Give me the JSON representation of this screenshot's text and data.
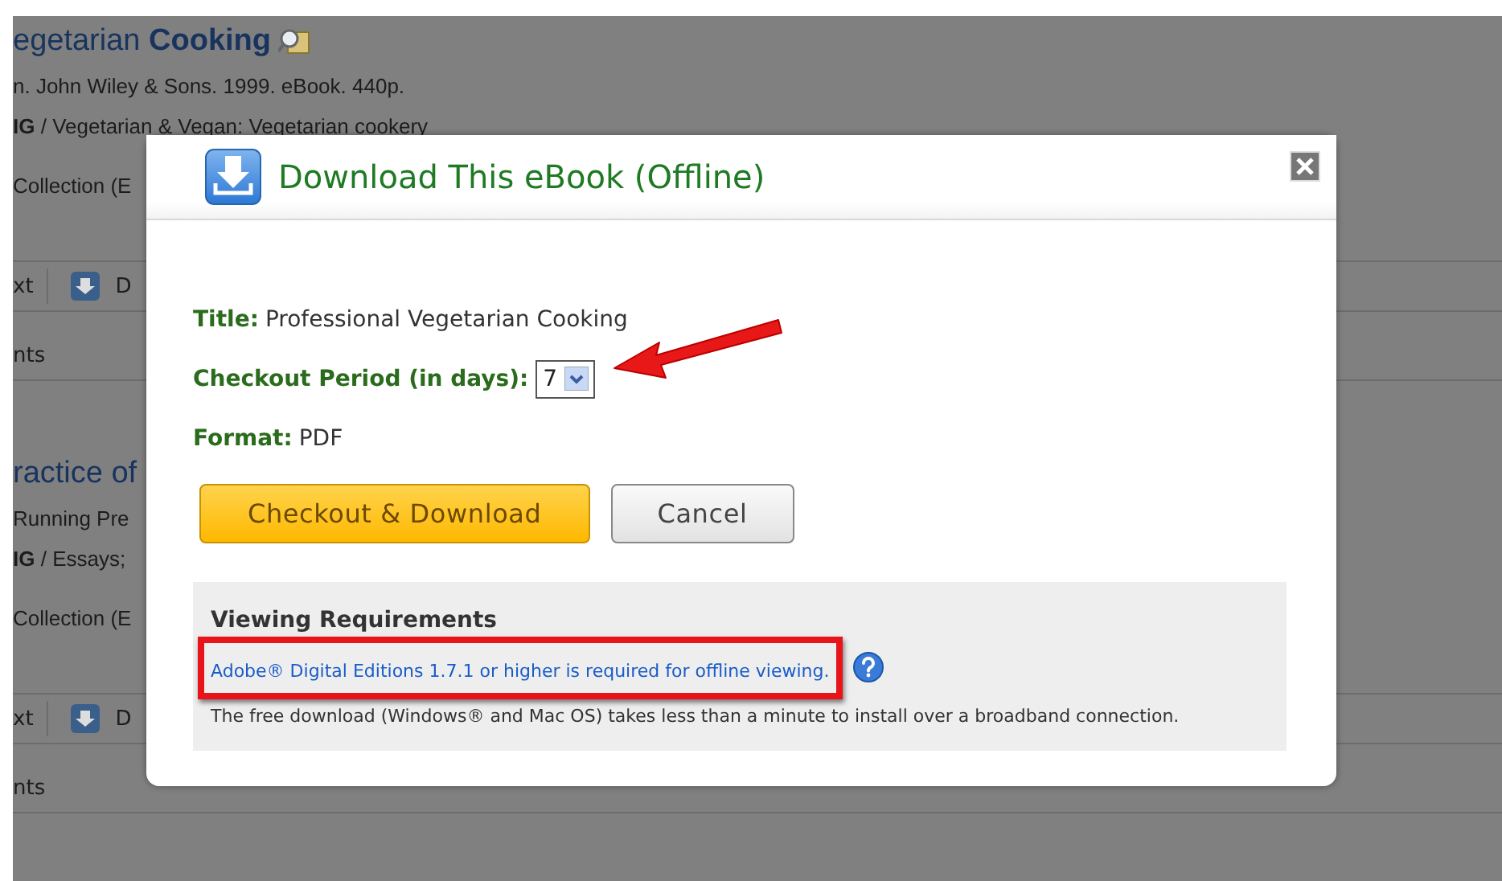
{
  "background_results": [
    {
      "title": "egetarian **Cooking**",
      "publisher": "n. John Wiley & Sons. 1999. eBook. 440p.",
      "subject_prefix": "IG",
      "subject": " / Vegetarian & Vegan: Vegetarian cookery",
      "collection": "Collection (E",
      "toolbar": [
        "xt",
        "D"
      ],
      "footer": "nts"
    },
    {
      "title": "ractice of",
      "publisher": "Running Pre",
      "subject_prefix": "IG",
      "subject": " / Essays;",
      "collection": "Collection (E",
      "toolbar": [
        "xt",
        "D"
      ],
      "footer": "nts"
    }
  ],
  "dialog": {
    "title": "Download This eBook (Offline)",
    "pointer_arrow": true,
    "fields": [
      {
        "kind": "text",
        "label": "Title:",
        "value": "Professional Vegetarian Cooking"
      },
      {
        "kind": "select",
        "label": "Checkout Period (in days):",
        "value": "7"
      },
      {
        "kind": "text",
        "label": "Format:",
        "value": "PDF"
      }
    ],
    "buttons": [
      {
        "kind": "primary",
        "label": "Checkout & Download"
      },
      {
        "kind": "secondary",
        "label": "Cancel"
      }
    ],
    "requirements": {
      "heading": "Viewing Requirements",
      "link": "Adobe® Digital Editions 1.7.1 or higher is required for offline viewing.",
      "highlighted": true,
      "note": "The free download (Windows® and Mac OS) takes less than a minute to install over a broadband connection."
    }
  }
}
